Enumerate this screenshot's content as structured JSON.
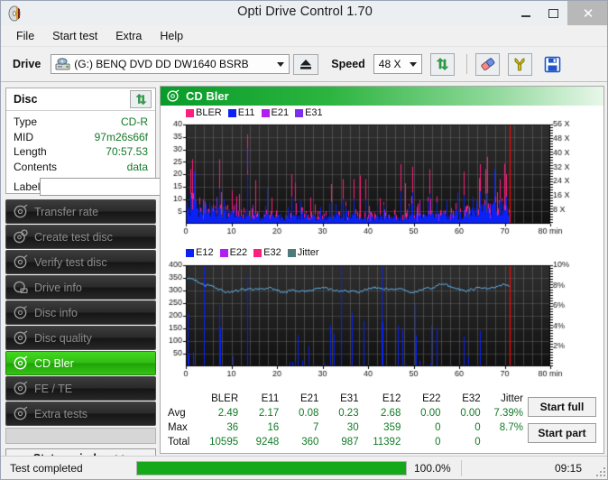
{
  "window": {
    "title": "Opti Drive Control 1.70",
    "app_icon": "cd-disc-icon",
    "minimize": "–",
    "maximize": "□",
    "close": "✕"
  },
  "menu": {
    "items": [
      {
        "label": "File"
      },
      {
        "label": "Start test"
      },
      {
        "label": "Extra"
      },
      {
        "label": "Help"
      }
    ]
  },
  "toolbar": {
    "drive_label": "Drive",
    "drive_value": "(G:)   BENQ DVD DD DW1640 BSRB",
    "eject_icon": "eject-icon",
    "speed_label": "Speed",
    "speed_value": "48 X",
    "refresh_icon": "refresh-arrows-icon",
    "erase_icon": "eraser-icon",
    "bookmark_icon": "clamp-icon",
    "save_icon": "floppy-save-icon"
  },
  "disc": {
    "title": "Disc",
    "refresh_icon": "refresh-arrows-icon",
    "rows": [
      {
        "key": "Type",
        "value": "CD-R"
      },
      {
        "key": "MID",
        "value": "97m26s66f"
      },
      {
        "key": "Length",
        "value": "70:57.53"
      },
      {
        "key": "Contents",
        "value": "data"
      }
    ],
    "label_key": "Label",
    "label_value": "",
    "label_placeholder": "",
    "cd_icon": "cd-disc-icon"
  },
  "nav": {
    "items": [
      {
        "label": "Transfer rate",
        "icon": "disc-scan-icon",
        "active": false
      },
      {
        "label": "Create test disc",
        "icon": "disc-write-icon",
        "active": false
      },
      {
        "label": "Verify test disc",
        "icon": "disc-verify-icon",
        "active": false
      },
      {
        "label": "Drive info",
        "icon": "drive-info-icon",
        "active": false
      },
      {
        "label": "Disc info",
        "icon": "disc-info-icon",
        "active": false
      },
      {
        "label": "Disc quality",
        "icon": "disc-quality-icon",
        "active": false
      },
      {
        "label": "CD Bler",
        "icon": "cd-bler-icon",
        "active": true
      },
      {
        "label": "FE / TE",
        "icon": "fe-te-icon",
        "active": false
      },
      {
        "label": "Extra tests",
        "icon": "extra-tests-icon",
        "active": false
      }
    ],
    "status_window": "Status window >>"
  },
  "content": {
    "header_title": "CD Bler",
    "header_icon": "cd-bler-icon"
  },
  "stats": {
    "columns": [
      "BLER",
      "E11",
      "E21",
      "E31",
      "E12",
      "E22",
      "E32",
      "Jitter"
    ],
    "rows": [
      {
        "label": "Avg",
        "values": [
          "2.49",
          "2.17",
          "0.08",
          "0.23",
          "2.68",
          "0.00",
          "0.00",
          "7.39%"
        ]
      },
      {
        "label": "Max",
        "values": [
          "36",
          "16",
          "7",
          "30",
          "359",
          "0",
          "0",
          "8.7%"
        ]
      },
      {
        "label": "Total",
        "values": [
          "10595",
          "9248",
          "360",
          "987",
          "11392",
          "0",
          "0",
          ""
        ]
      }
    ]
  },
  "actions": {
    "start_full": "Start full",
    "start_part": "Start part"
  },
  "statusbar": {
    "message": "Test completed",
    "progress_percent": 100.0,
    "progress_text": "100.0%",
    "elapsed": "09:15"
  },
  "chart_data": [
    {
      "type": "area",
      "id": "cd-bler-chart",
      "title": "CD Bler",
      "xlabel": "min",
      "ylabel": "",
      "xlim": [
        0,
        80
      ],
      "ylim": [
        0,
        40
      ],
      "xticks": [
        0,
        10,
        20,
        30,
        40,
        50,
        60,
        70,
        80
      ],
      "xticklabels": [
        "0",
        "10",
        "20",
        "30",
        "40",
        "50",
        "60",
        "70",
        "80 min"
      ],
      "yticks": [
        5,
        10,
        15,
        20,
        25,
        30,
        35,
        40
      ],
      "yticklabels": [
        "5",
        "10",
        "15",
        "20",
        "25",
        "30",
        "35",
        "40"
      ],
      "right_axis_label": "X",
      "right_ticks": [
        8,
        16,
        24,
        32,
        40,
        48,
        56
      ],
      "right_ticklabels": [
        "8 X",
        "16 X",
        "24 X",
        "32 X",
        "40 X",
        "48 X",
        "56 X"
      ],
      "right_ylim": [
        0,
        56
      ],
      "grid": true,
      "legend_position": "top-left",
      "data_end_min": 71,
      "series": [
        {
          "name": "BLER",
          "color": "#ff1e7d",
          "avg": 2.49,
          "max": 36,
          "total": 10595
        },
        {
          "name": "E11",
          "color": "#0a22f5",
          "avg": 2.17,
          "max": 16,
          "total": 9248
        },
        {
          "name": "E21",
          "color": "#b01ef0",
          "avg": 0.08,
          "max": 7,
          "total": 360
        },
        {
          "name": "E31",
          "color": "#7a2ef0",
          "avg": 0.23,
          "max": 30,
          "total": 987
        }
      ],
      "speed_marker": {
        "color": "#e31010",
        "at_min": 71,
        "note": "write speed trace ends at 71 min"
      }
    },
    {
      "type": "line",
      "id": "cd-bler-e12-jitter-chart",
      "title": "",
      "xlabel": "min",
      "ylabel": "",
      "xlim": [
        0,
        80
      ],
      "ylim": [
        0,
        400
      ],
      "xticks": [
        0,
        10,
        20,
        30,
        40,
        50,
        60,
        70,
        80
      ],
      "xticklabels": [
        "0",
        "10",
        "20",
        "30",
        "40",
        "50",
        "60",
        "70",
        "80 min"
      ],
      "yticks": [
        50,
        100,
        150,
        200,
        250,
        300,
        350,
        400
      ],
      "yticklabels": [
        "50",
        "100",
        "150",
        "200",
        "250",
        "300",
        "350",
        "400"
      ],
      "right_ticks": [
        2,
        4,
        6,
        8,
        10
      ],
      "right_ticklabels": [
        "2%",
        "4%",
        "6%",
        "8%",
        "10%"
      ],
      "right_ylim": [
        0,
        10
      ],
      "grid": true,
      "legend_position": "top-left",
      "data_end_min": 71,
      "series": [
        {
          "name": "E12",
          "color": "#0a22f5",
          "avg": 2.68,
          "max": 359,
          "total": 11392
        },
        {
          "name": "E22",
          "color": "#b01ef0",
          "avg": 0.0,
          "max": 0,
          "total": 0
        },
        {
          "name": "E32",
          "color": "#ff1e7d",
          "avg": 0.0,
          "max": 0,
          "total": 0
        },
        {
          "name": "Jitter",
          "color": "#4aa3e8",
          "avg": 7.39,
          "max": 8.7,
          "units": "%"
        }
      ],
      "speed_marker": {
        "color": "#e31010",
        "at_min": 71
      }
    }
  ]
}
